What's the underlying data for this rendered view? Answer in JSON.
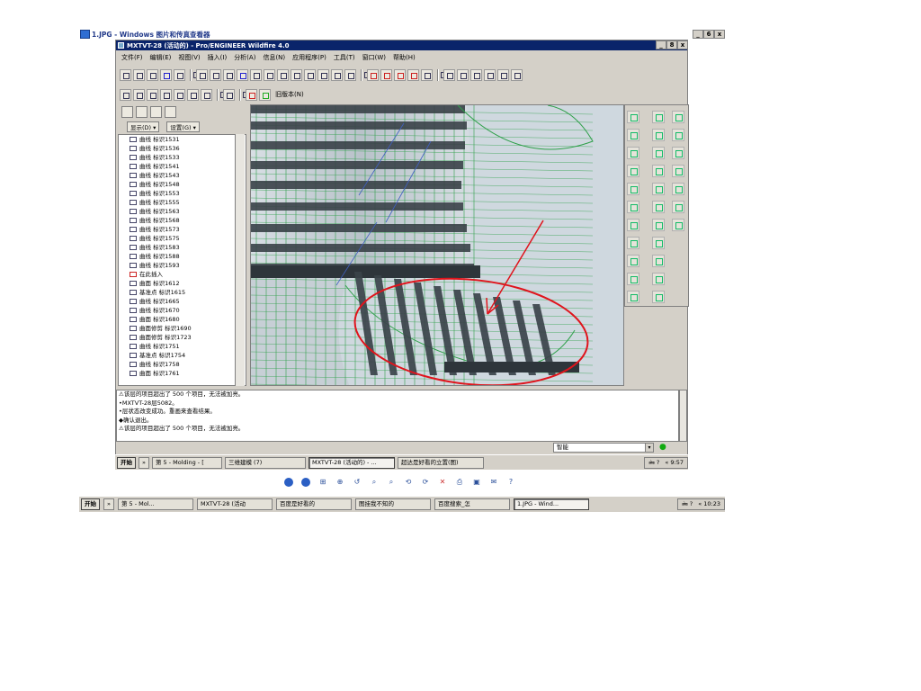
{
  "viewer": {
    "title": "1.JPG - Windows 图片和传真查看器",
    "buttons": {
      "minimize": "_",
      "maximize": "6",
      "close": "x"
    }
  },
  "app": {
    "title": "MXTVT-28 (活动的) - Pro/ENGINEER Wildfire 4.0",
    "buttons": {
      "minimize": "_",
      "maximize": "8",
      "close": "x"
    },
    "menu": [
      "文件(F)",
      "编辑(E)",
      "视图(V)",
      "插入(I)",
      "分析(A)",
      "信息(N)",
      "应用程序(P)",
      "工具(T)",
      "窗口(W)",
      "帮助(H)"
    ],
    "model_tab_label": "旧版本(N)"
  },
  "nav": {
    "display_dropdown": "显示(D) ▾",
    "settings_dropdown": "设置(G) ▾",
    "tree": [
      {
        "label": "曲线 标识1531",
        "kind": "curve"
      },
      {
        "label": "曲线 标识1536",
        "kind": "curve"
      },
      {
        "label": "曲线 标识1533",
        "kind": "curve"
      },
      {
        "label": "曲线 标识1541",
        "kind": "curve"
      },
      {
        "label": "曲线 标识1543",
        "kind": "curve"
      },
      {
        "label": "曲线 标识1548",
        "kind": "curve"
      },
      {
        "label": "曲线 标识1553",
        "kind": "curve"
      },
      {
        "label": "曲线 标识1555",
        "kind": "curve"
      },
      {
        "label": "曲线 标识1563",
        "kind": "curve"
      },
      {
        "label": "曲线 标识1568",
        "kind": "curve"
      },
      {
        "label": "曲线 标识1573",
        "kind": "curve"
      },
      {
        "label": "曲线 标识1575",
        "kind": "curve"
      },
      {
        "label": "曲线 标识1583",
        "kind": "curve"
      },
      {
        "label": "曲线 标识1588",
        "kind": "curve"
      },
      {
        "label": "曲线 标识1593",
        "kind": "curve"
      },
      {
        "label": "在此插入",
        "kind": "feat"
      },
      {
        "label": "曲面 标识1612",
        "kind": "curve"
      },
      {
        "label": "基准点 标识1615",
        "kind": "curve"
      },
      {
        "label": "曲线 标识1665",
        "kind": "curve"
      },
      {
        "label": "曲线 标识1670",
        "kind": "curve"
      },
      {
        "label": "曲面 标识1680",
        "kind": "curve"
      },
      {
        "label": "曲面修剪 标识1690",
        "kind": "curve"
      },
      {
        "label": "曲面修剪 标识1723",
        "kind": "curve"
      },
      {
        "label": "曲线 标识1751",
        "kind": "curve"
      },
      {
        "label": "基准点 标识1754",
        "kind": "curve"
      },
      {
        "label": "曲线 标识1758",
        "kind": "curve"
      },
      {
        "label": "曲面 标识1761",
        "kind": "curve"
      }
    ]
  },
  "messages": [
    "⚠该层的项目超出了 500 个项目，无法被加亮。",
    "•MXTVT-28层5082。",
    "•层状态改变成功。重画来查看结果。",
    "◆确认退出。",
    "⚠该层的项目超出了 500 个项目，无法被加亮。"
  ],
  "filter": {
    "value": "智能",
    "arrow": "▾"
  },
  "inner_taskbar": {
    "start": "开始",
    "quick": "»",
    "tasks": [
      "第 5 - Molding - [",
      "三维建模 (7)",
      "MXTVT-28 (活动的) - ...",
      "超达是好看的立置(图)"
    ],
    "active_index": 2,
    "tray": {
      "icons": "🖮 ?",
      "clock": "« 9:57"
    }
  },
  "viewer_tools": [
    "◀",
    "▶",
    "⊞",
    "⊕",
    "↺",
    "⌕",
    "⌕",
    "⟲",
    "⟳",
    "✕",
    "⎙",
    "▣",
    "✉",
    "?"
  ],
  "outer_taskbar": {
    "start": "开始",
    "quick": "»",
    "tasks": [
      "第 5 - Mol...",
      "MXTVT-28 (活动",
      "百度是好看的",
      "图挂我不知的",
      "百度搜索_怎",
      "1.JPG - Wind..."
    ],
    "active_index": 5,
    "tray": {
      "icons": "🖮 ?",
      "clock": "« 10:23"
    }
  },
  "colors": {
    "title_active": "#0a246a",
    "mesh_green": "#2fa04a",
    "annotation_red": "#e0141c",
    "model_surface": "#cfd6dc"
  }
}
